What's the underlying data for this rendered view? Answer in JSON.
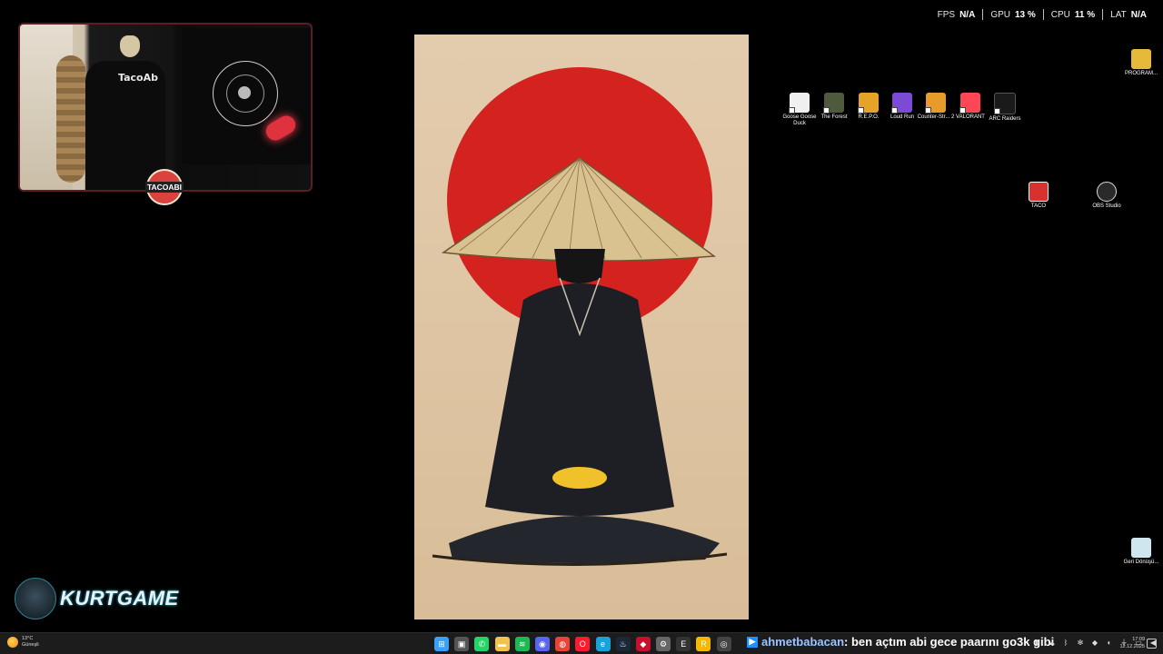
{
  "overlay": {
    "fps_label": "FPS",
    "fps_value": "N/A",
    "gpu_label": "GPU",
    "gpu_value": "13 %",
    "cpu_label": "CPU",
    "cpu_value": "11 %",
    "lat_label": "LAT",
    "lat_value": "N/A"
  },
  "webcam": {
    "chair_text": "TacoAb",
    "badge": "TACOABI"
  },
  "desktop_icons": [
    {
      "label": "PROGRAM...",
      "icon": "folder-icon",
      "color": "#e6b93a"
    },
    {
      "label": "Goose Goose Duck",
      "icon": "goose-goose-duck-icon",
      "color": "#f0f0f0"
    },
    {
      "label": "The Forest",
      "icon": "the-forest-icon",
      "color": "#4f5a3c"
    },
    {
      "label": "R.E.P.O.",
      "icon": "repo-icon",
      "color": "#e5a328"
    },
    {
      "label": "Loud Run",
      "icon": "loud-run-icon",
      "color": "#7b4bd6"
    },
    {
      "label": "Counter-Str... 2",
      "icon": "counter-strike-icon",
      "color": "#e89a2a"
    },
    {
      "label": "VALORANT",
      "icon": "valorant-icon",
      "color": "#ff4655"
    },
    {
      "label": "ARC Raiders",
      "icon": "arc-raiders-icon",
      "color": "#1a1a1a"
    },
    {
      "label": "TACO",
      "icon": "taco-power-icon",
      "color": "#d9312e"
    },
    {
      "label": "OBS Studio",
      "icon": "obs-studio-icon",
      "color": "#2a2a2a"
    },
    {
      "label": "Geri Dönüşü...",
      "icon": "recycle-bin-icon",
      "color": "#cfe6ef"
    }
  ],
  "logo": {
    "text": "KURTGAME"
  },
  "taskbar": {
    "weather_temp": "13°C",
    "weather_desc": "Güneşli",
    "apps": [
      {
        "name": "windows-start-icon",
        "glyph": "⊞",
        "color": "#3aa0ff"
      },
      {
        "name": "task-view-icon",
        "glyph": "▣",
        "color": "#555"
      },
      {
        "name": "whatsapp-icon",
        "glyph": "✆",
        "color": "#25d366"
      },
      {
        "name": "file-explorer-icon",
        "glyph": "▬",
        "color": "#f2c14e"
      },
      {
        "name": "spotify-icon",
        "glyph": "≋",
        "color": "#1db954"
      },
      {
        "name": "discord-icon",
        "glyph": "◉",
        "color": "#5865f2"
      },
      {
        "name": "chrome-icon",
        "glyph": "◍",
        "color": "#e84336"
      },
      {
        "name": "opera-icon",
        "glyph": "O",
        "color": "#ff1b2d"
      },
      {
        "name": "edge-icon",
        "glyph": "e",
        "color": "#1aa3d9"
      },
      {
        "name": "steam-icon",
        "glyph": "♨",
        "color": "#1b2838"
      },
      {
        "name": "app-red-icon",
        "glyph": "◆",
        "color": "#c8102e"
      },
      {
        "name": "settings-icon",
        "glyph": "⚙",
        "color": "#666"
      },
      {
        "name": "epic-games-icon",
        "glyph": "E",
        "color": "#333"
      },
      {
        "name": "rockstar-icon",
        "glyph": "R",
        "color": "#f5b800"
      },
      {
        "name": "obs-taskbar-icon",
        "glyph": "◎",
        "color": "#444"
      }
    ],
    "chat_user": "ahmetbabacan",
    "chat_message": ": ben açtım abi gece paarını go3k gibi",
    "tray_icons": [
      "⬆",
      "☁",
      "ᛒ",
      "✻",
      "◆",
      "◐",
      "⏚",
      "▭",
      "◀",
      "⏷"
    ],
    "time": "17:09",
    "date": "12.12.2025"
  }
}
